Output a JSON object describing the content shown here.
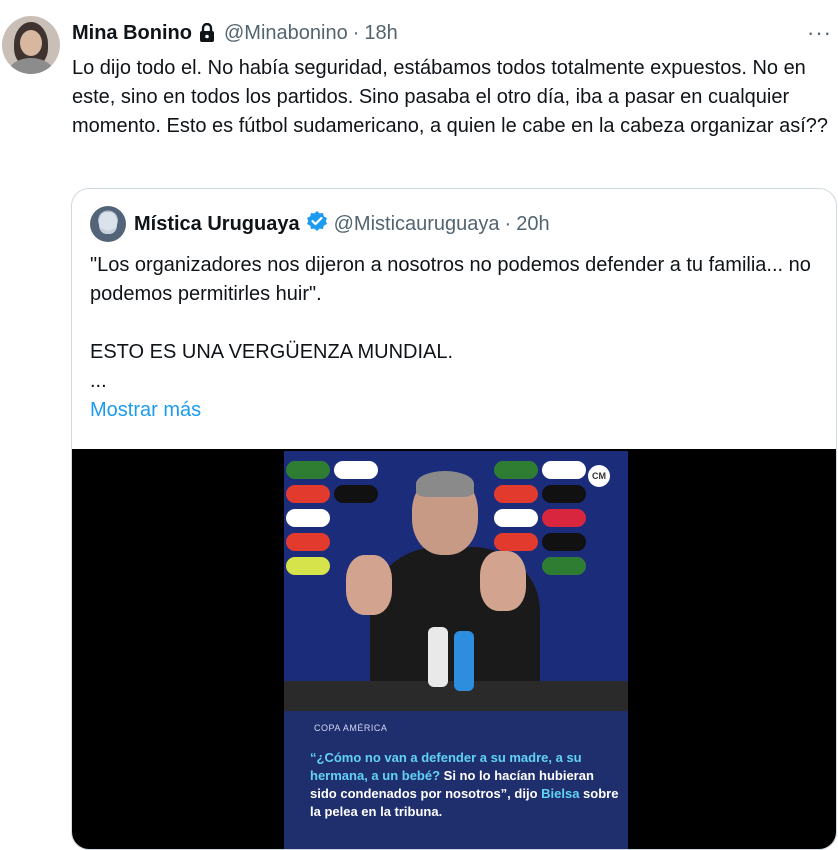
{
  "tweet": {
    "author_name": "Mina Bonino",
    "handle": "@Minabonino",
    "time": "18h",
    "separator": "·",
    "more_label": "···",
    "text": "Lo dijo todo el. No había seguridad, estábamos todos totalmente expuestos. No en este, sino en todos los partidos. Sino pasaba el otro día, iba a pasar en cualquier momento. Esto es fútbol sudamericano, a quien le cabe en la cabeza organizar así??"
  },
  "quote": {
    "author_name": "Mística Uruguaya",
    "handle": "@Misticauruguaya",
    "time": "20h",
    "separator": "·",
    "text": "\"Los organizadores nos dijeron a nosotros no podemos defender a tu familia... no podemos permitirles huir\".\n\nESTO ES UNA VERGÜENZA MUNDIAL.\n...",
    "show_more": "Mostrar más"
  },
  "media": {
    "tag": "COPA AMÉRICA",
    "badge": "CM",
    "caption_q_open": "“¿Cómo no van a defender a su madre, a su hermana, a un bebé?",
    "caption_main": " Si no lo hacían hubieran sido condenados por nosotros”, dijo ",
    "caption_name": "Bielsa",
    "caption_end": " sobre la pelea en la tribuna."
  },
  "colors": {
    "link": "#1d9bf0",
    "muted": "#536471",
    "verified": "#1d9bf0",
    "caption_highlight": "#61d2f5"
  }
}
